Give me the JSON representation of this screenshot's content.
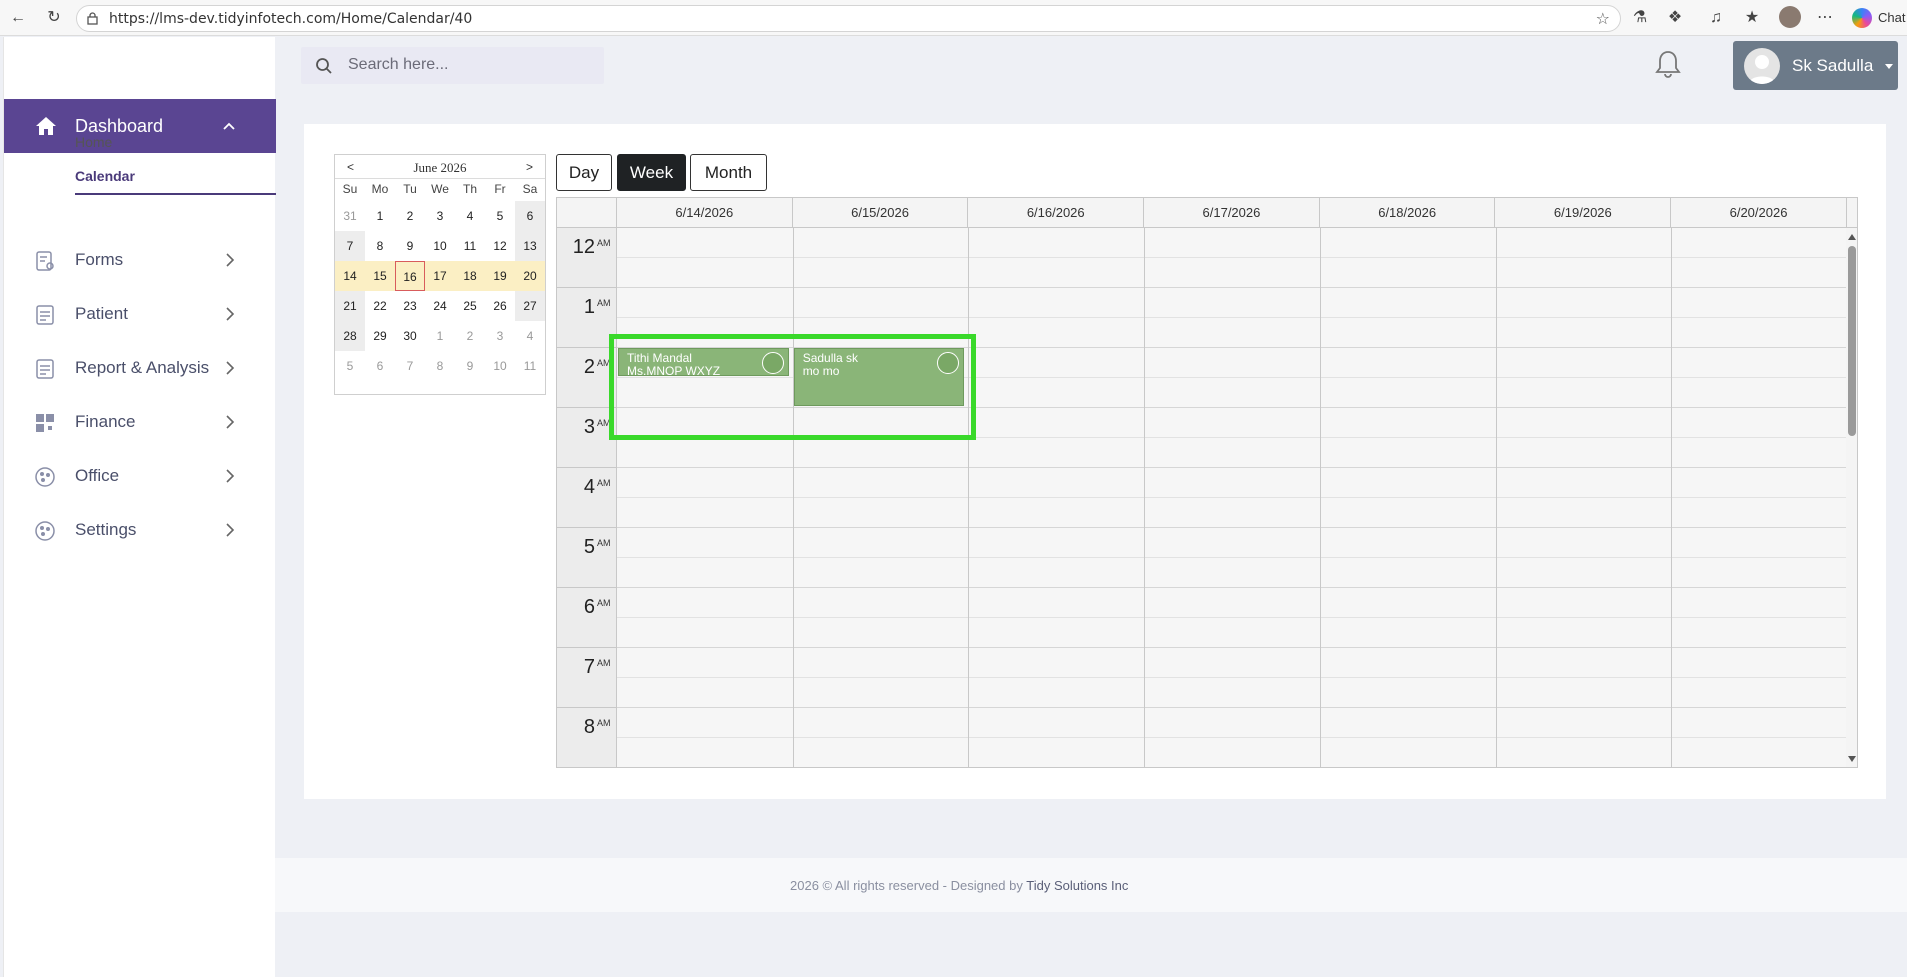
{
  "browser": {
    "url": "https://lms-dev.tidyinfotech.com/Home/Calendar/40",
    "chat_label": "Chat"
  },
  "header": {
    "search_placeholder": "Search here...",
    "user_name": "Sk Sadulla"
  },
  "sidebar": {
    "dashboard_label": "Dashboard",
    "sub_items": [
      "Home",
      "Calendar"
    ],
    "items": [
      {
        "label": "Forms",
        "icon": "forms-icon"
      },
      {
        "label": "Patient",
        "icon": "patient-icon"
      },
      {
        "label": "Report & Analysis",
        "icon": "report-icon"
      },
      {
        "label": "Finance",
        "icon": "finance-icon"
      },
      {
        "label": "Office",
        "icon": "office-icon"
      },
      {
        "label": "Settings",
        "icon": "settings-icon"
      }
    ]
  },
  "mini_calendar": {
    "title": "June 2026",
    "prev": "<",
    "next": ">",
    "dow": [
      "Su",
      "Mo",
      "Tu",
      "We",
      "Th",
      "Fr",
      "Sa"
    ],
    "weeks": [
      [
        "31",
        "1",
        "2",
        "3",
        "4",
        "5",
        "6"
      ],
      [
        "7",
        "8",
        "9",
        "10",
        "11",
        "12",
        "13"
      ],
      [
        "14",
        "15",
        "16",
        "17",
        "18",
        "19",
        "20"
      ],
      [
        "21",
        "22",
        "23",
        "24",
        "25",
        "26",
        "27"
      ],
      [
        "28",
        "29",
        "30",
        "1",
        "2",
        "3",
        "4"
      ],
      [
        "5",
        "6",
        "7",
        "8",
        "9",
        "10",
        "11"
      ]
    ],
    "today": "16",
    "selected_week": 2
  },
  "views": {
    "day": "Day",
    "week": "Week",
    "month": "Month",
    "active": "Week"
  },
  "week": {
    "dates": [
      "6/14/2026",
      "6/15/2026",
      "6/16/2026",
      "6/17/2026",
      "6/18/2026",
      "6/19/2026",
      "6/20/2026"
    ],
    "hours": [
      "12",
      "1",
      "2",
      "3",
      "4",
      "5",
      "6",
      "7",
      "8"
    ],
    "ampm": "AM",
    "events": [
      {
        "line1": "Tithi Mandal",
        "line2": "Ms.MNOP WXYZ",
        "day": 0,
        "start": 2.0,
        "end": 2.5
      },
      {
        "line1": "Sadulla sk",
        "line2": "mo mo",
        "day": 1,
        "start": 2.0,
        "end": 3.0
      }
    ]
  },
  "footer": {
    "text": "2026 © All rights reserved - Designed by ",
    "brand": "Tidy Solutions Inc"
  },
  "colors": {
    "sidebar_active": "#5a4592",
    "event_green": "#8ab578",
    "highlight": "#39d92a",
    "user_button": "#6c7a89"
  }
}
